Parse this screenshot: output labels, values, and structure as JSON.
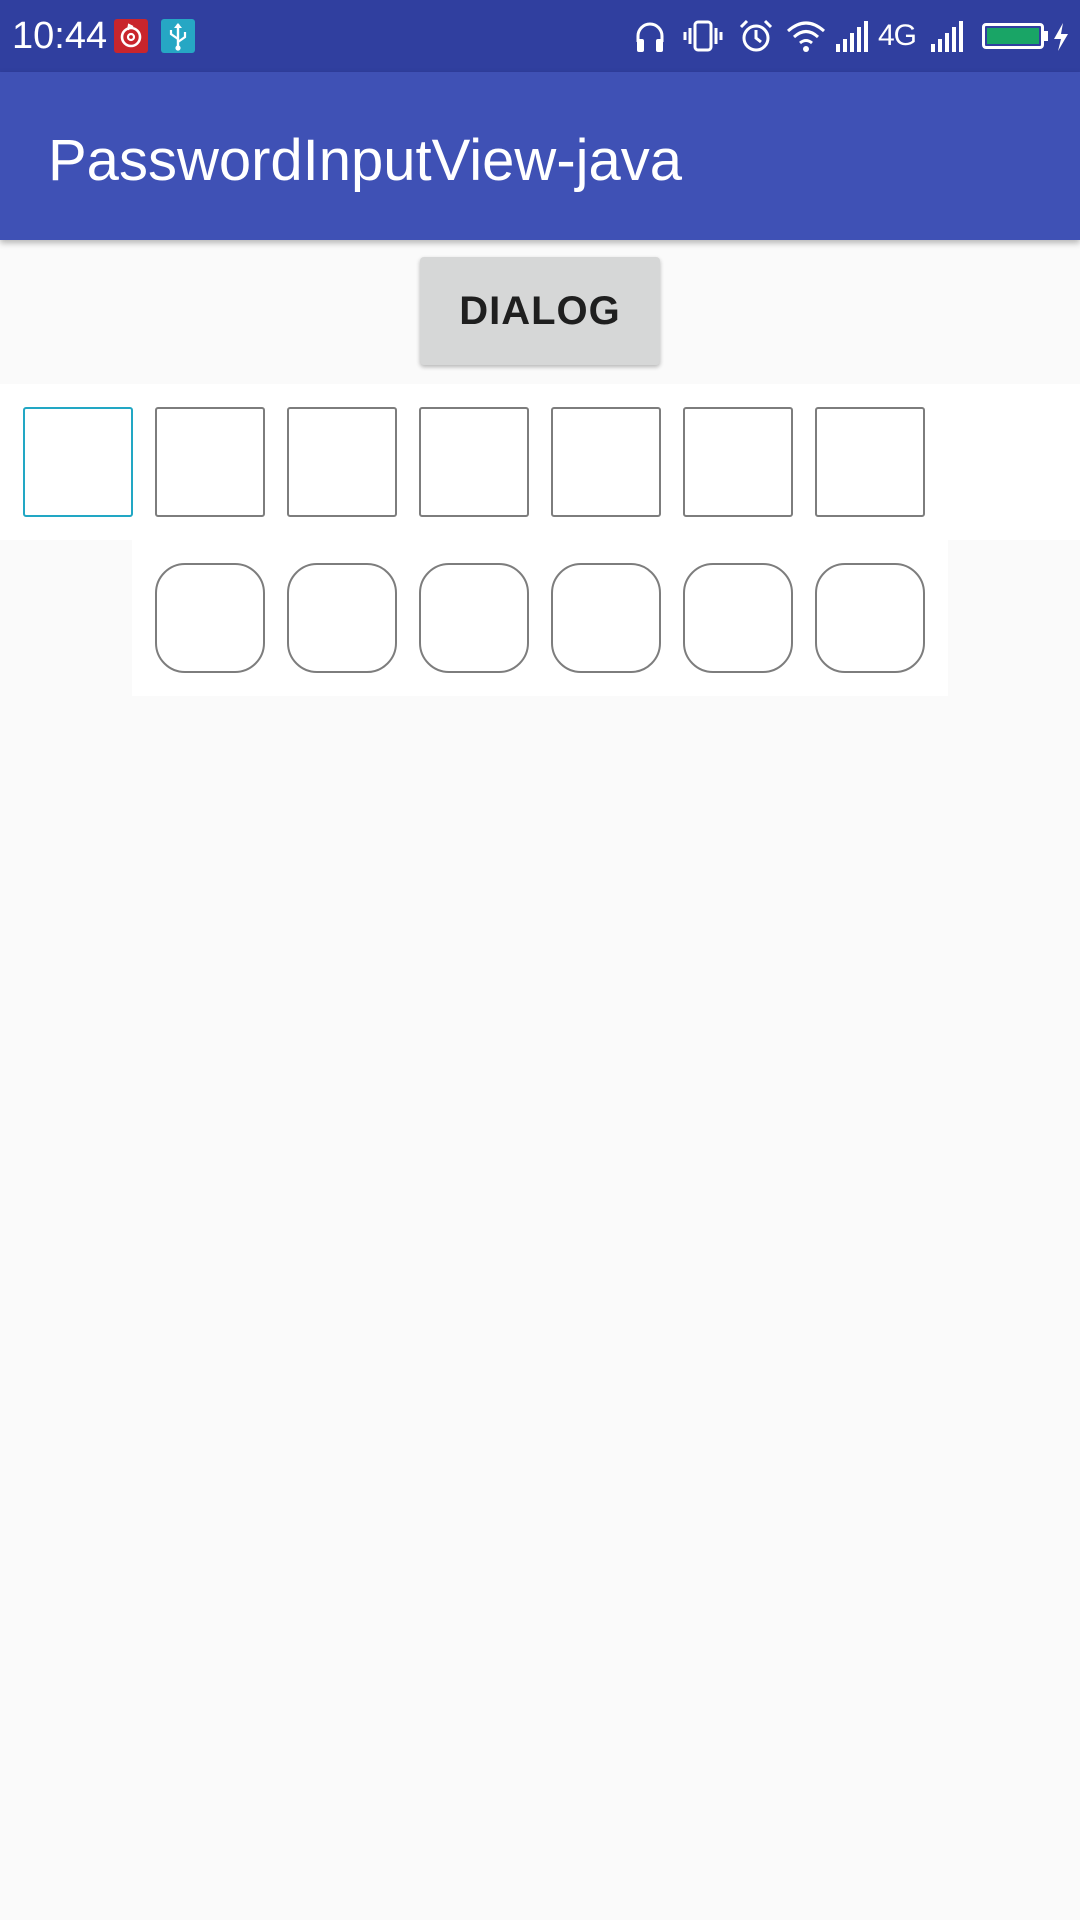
{
  "status_bar": {
    "time": "10:44",
    "notification_icons": [
      "netease-music-icon",
      "usb-icon"
    ],
    "system_icons": [
      "headphones-icon",
      "vibrate-icon",
      "alarm-icon",
      "wifi-icon",
      "signal-icon",
      "signal-icon"
    ],
    "network_label": "4G",
    "battery_level": 1.0,
    "battery_color": "#19a566"
  },
  "app_bar": {
    "title": "PasswordInputView-java",
    "color": "#3f51b5"
  },
  "main": {
    "dialog_button_label": "DIALOG",
    "password_square": {
      "length": 7,
      "focused_index": 0,
      "focus_color": "#22a7c4"
    },
    "password_rounded": {
      "length": 6
    }
  }
}
